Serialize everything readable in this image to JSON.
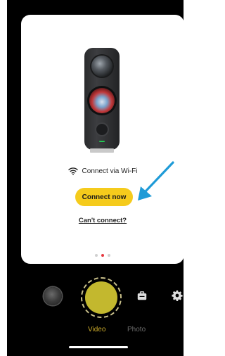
{
  "onboarding": {
    "wifi_label": "Connect via Wi-Fi",
    "connect_button": "Connect now",
    "cant_connect_link": "Can't connect?",
    "page_indicator": {
      "count": 3,
      "active_index": 1
    }
  },
  "capture": {
    "modes": [
      "Video",
      "Photo"
    ],
    "selected_mode": "Video"
  },
  "colors": {
    "accent_yellow": "#f5cb1c",
    "arrow_blue": "#1f9bd7",
    "active_dot": "#e63940",
    "video_label": "#c9a92a"
  },
  "icons": [
    "wifi-icon",
    "arrow-icon",
    "toolbox-icon",
    "settings-gear-icon"
  ]
}
